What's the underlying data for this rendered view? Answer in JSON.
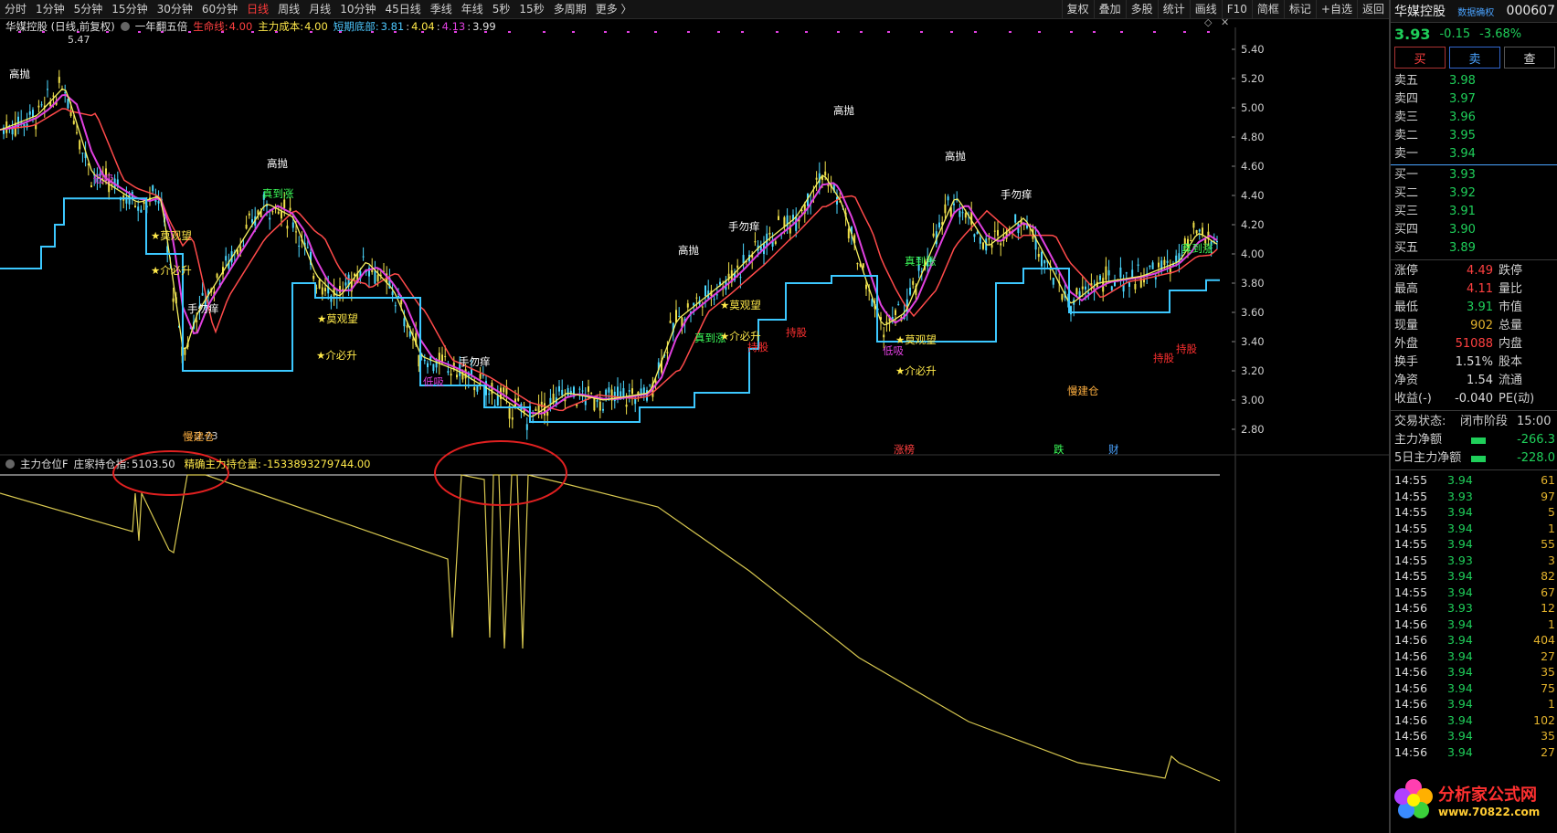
{
  "period_bar": {
    "items": [
      "分时",
      "1分钟",
      "5分钟",
      "15分钟",
      "30分钟",
      "60分钟",
      "日线",
      "周线",
      "月线",
      "10分钟",
      "45日线",
      "季线",
      "年线",
      "5秒",
      "15秒",
      "多周期",
      "更多 〉"
    ],
    "active_index": 6,
    "tools": [
      "复权",
      "叠加",
      "多股",
      "统计",
      "画线",
      "F10",
      "简框",
      "标记",
      "+自选",
      "返回"
    ]
  },
  "legend_main": {
    "stock": "华媒控股 (日线,前复权)",
    "indicator": "一年翻五倍",
    "life_line_label": "生命线:",
    "life_line_value": "4.00",
    "cost_label": "主力成本:",
    "cost_value": "4.00",
    "bottom_label": "短期底部:",
    "bottom_values": [
      "3.81",
      "4.04",
      "4.13",
      "3.99"
    ]
  },
  "legend_sub": {
    "name": "主力仓位F",
    "hold_label": "庄家持仓指:",
    "hold_value": "5103.50",
    "precise_label": "精确主力持仓量:",
    "precise_value": "-1533893279744.00"
  },
  "price_axis": [
    "5.40",
    "5.20",
    "5.00",
    "4.80",
    "4.60",
    "4.40",
    "4.20",
    "4.00",
    "3.80",
    "3.60",
    "3.40",
    "3.20",
    "3.00",
    "2.80"
  ],
  "price_annotations": {
    "high": "5.47",
    "low": "2.73"
  },
  "chart_labels": [
    {
      "t": "高抛",
      "c": "#ffffff"
    },
    {
      "t": "低吸",
      "c": "#e040e0"
    },
    {
      "t": "★莫观望",
      "c": "#ffe94a"
    },
    {
      "t": "★介必升",
      "c": "#ffe94a"
    },
    {
      "t": "手勿痒",
      "c": "#ffffff"
    },
    {
      "t": "高抛",
      "c": "#ffffff"
    },
    {
      "t": "真到涨",
      "c": "#3cff5a"
    },
    {
      "t": "★莫观望",
      "c": "#ffe94a"
    },
    {
      "t": "★介必升",
      "c": "#ffe94a"
    },
    {
      "t": "低吸",
      "c": "#e040e0"
    },
    {
      "t": "手勿痒",
      "c": "#ffffff"
    },
    {
      "t": "高抛",
      "c": "#ffffff"
    },
    {
      "t": "真到涨",
      "c": "#3cff5a"
    },
    {
      "t": "★莫观望",
      "c": "#ffe94a"
    },
    {
      "t": "★介必升",
      "c": "#ffe94a"
    },
    {
      "t": "持股",
      "c": "#ff3030"
    },
    {
      "t": "手勿痒",
      "c": "#ffffff"
    },
    {
      "t": "持股",
      "c": "#ff3030"
    },
    {
      "t": "高抛",
      "c": "#ffffff"
    },
    {
      "t": "低吸",
      "c": "#e040e0"
    },
    {
      "t": "真到涨",
      "c": "#3cff5a"
    },
    {
      "t": "★莫观望",
      "c": "#ffe94a"
    },
    {
      "t": "★介必升",
      "c": "#ffe94a"
    },
    {
      "t": "高抛",
      "c": "#ffffff"
    },
    {
      "t": "手勿痒",
      "c": "#ffffff"
    },
    {
      "t": "慢建仓",
      "c": "#ffb040"
    },
    {
      "t": "持股",
      "c": "#ff3030"
    },
    {
      "t": "持股",
      "c": "#ff3030"
    },
    {
      "t": "真到涨",
      "c": "#3cff5a"
    },
    {
      "t": "慢建仓",
      "c": "#ffb040"
    }
  ],
  "info_marks": [
    {
      "t": "涨榜",
      "c": "#ff4040"
    },
    {
      "t": "跌",
      "c": "#3cff5a"
    },
    {
      "t": "财",
      "c": "#4aa3ff"
    }
  ],
  "quote": {
    "name": "华媒控股",
    "code": "000607",
    "tag": "数据确权",
    "last": "3.93",
    "change": "-0.15",
    "change_pct": "-3.68%",
    "buy_label": "买",
    "sell_label": "卖",
    "check_label": "查",
    "asks": [
      [
        "卖五",
        "3.98"
      ],
      [
        "卖四",
        "3.97"
      ],
      [
        "卖三",
        "3.96"
      ],
      [
        "卖二",
        "3.95"
      ],
      [
        "卖一",
        "3.94"
      ]
    ],
    "bids": [
      [
        "买一",
        "3.93"
      ],
      [
        "买二",
        "3.92"
      ],
      [
        "买三",
        "3.91"
      ],
      [
        "买四",
        "3.90"
      ],
      [
        "买五",
        "3.89"
      ]
    ],
    "stats": [
      {
        "k": "涨停",
        "v": "4.49",
        "vc": "#ff4040",
        "k2": "跌停"
      },
      {
        "k": "最高",
        "v": "4.11",
        "vc": "#ff4040",
        "k2": "量比"
      },
      {
        "k": "最低",
        "v": "3.91",
        "vc": "#1fcf5a",
        "k2": "市值"
      },
      {
        "k": "现量",
        "v": "902",
        "vc": "#e2b22c",
        "k2": "总量"
      },
      {
        "k": "外盘",
        "v": "51088",
        "vc": "#ff4040",
        "k2": "内盘"
      },
      {
        "k": "换手",
        "v": "1.51%",
        "vc": "#dcdcdc",
        "k2": "股本"
      },
      {
        "k": "净资",
        "v": "1.54",
        "vc": "#dcdcdc",
        "k2": "流通"
      },
      {
        "k": "收益(-)",
        "v": "-0.040",
        "vc": "#dcdcdc",
        "k2": "PE(动)"
      }
    ],
    "trade_status_label": "交易状态:",
    "trade_status_value": "闭市阶段",
    "trade_time": "15:00",
    "net_main_label": "主力净额",
    "net_main_value": "-266.3",
    "net_main5_label": "5日主力净额",
    "net_main5_value": "-228.0",
    "ticks": [
      [
        "14:55",
        "3.94",
        "61"
      ],
      [
        "14:55",
        "3.93",
        "97"
      ],
      [
        "14:55",
        "3.94",
        "5"
      ],
      [
        "14:55",
        "3.94",
        "1"
      ],
      [
        "14:55",
        "3.94",
        "55"
      ],
      [
        "14:55",
        "3.93",
        "3"
      ],
      [
        "14:55",
        "3.94",
        "82"
      ],
      [
        "14:55",
        "3.94",
        "67"
      ],
      [
        "14:56",
        "3.93",
        "12"
      ],
      [
        "14:56",
        "3.94",
        "1"
      ],
      [
        "14:56",
        "3.94",
        "404"
      ],
      [
        "14:56",
        "3.94",
        "27"
      ],
      [
        "14:56",
        "3.94",
        "35"
      ],
      [
        "14:56",
        "3.94",
        "75"
      ],
      [
        "14:56",
        "3.94",
        "1"
      ],
      [
        "14:56",
        "3.94",
        "102"
      ],
      [
        "14:56",
        "3.94",
        "35"
      ],
      [
        "14:56",
        "3.94",
        "27"
      ]
    ]
  },
  "logo": {
    "text": "分析家公式网",
    "url": "www.70822.com"
  }
}
